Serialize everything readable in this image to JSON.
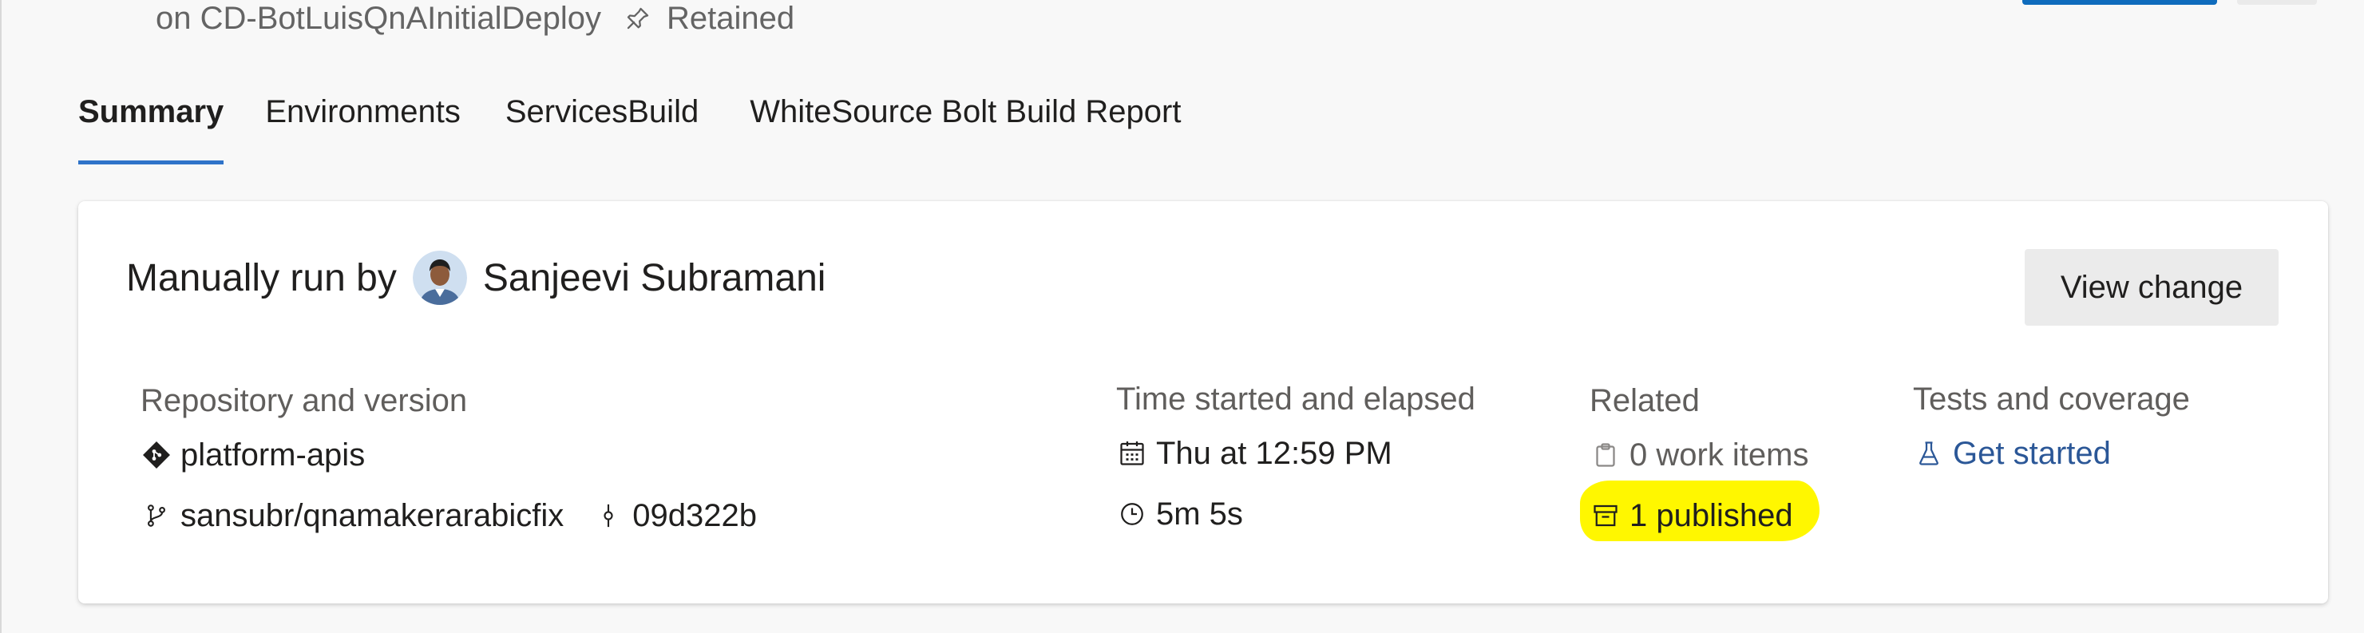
{
  "header": {
    "subtitle": "on CD-BotLuisQnAInitialDeploy",
    "retained_label": "Retained"
  },
  "tabs": [
    {
      "label": "Summary",
      "active": true
    },
    {
      "label": "Environments",
      "active": false
    },
    {
      "label": "ServicesBuild",
      "active": false
    },
    {
      "label": "WhiteSource Bolt Build Report",
      "active": false
    }
  ],
  "summary": {
    "run_prefix": "Manually run by",
    "user_name": "Sanjeevi Subramani",
    "view_change_label": "View change",
    "repository": {
      "label": "Repository and version",
      "repo_name": "platform-apis",
      "branch": "sansubr/qnamakerarabicfix",
      "commit": "09d322b"
    },
    "time": {
      "label": "Time started and elapsed",
      "started": "Thu at 12:59 PM",
      "elapsed": "5m 5s"
    },
    "related": {
      "label": "Related",
      "work_items": "0 work items",
      "published": "1 published"
    },
    "tests": {
      "label": "Tests and coverage",
      "get_started": "Get started"
    }
  },
  "colors": {
    "accent": "#2f73c9",
    "link": "#2b5797",
    "highlight": "#fff700"
  }
}
